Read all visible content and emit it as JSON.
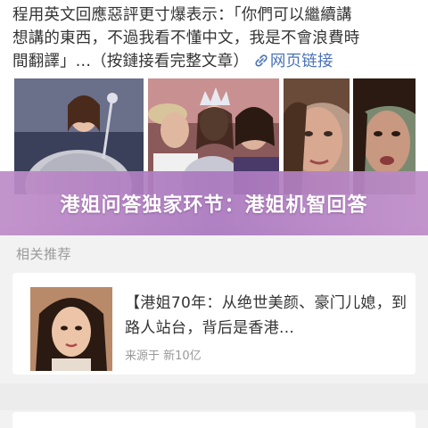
{
  "article": {
    "line1": "程用英文回應惡評更寸爆表示：「你們可以繼續講",
    "line2": "想講的東西，不過我看不懂中文，我是不會浪費時",
    "line3_text": "間翻譯」...（按鏈接看完整文章）",
    "link_label": "网页链接",
    "link_icon": "link-icon"
  },
  "photos": [
    {
      "name": "pageant-winner-photo"
    },
    {
      "name": "crowning-group-photo"
    },
    {
      "name": "portrait-closeup-photo"
    },
    {
      "name": "selfie-photo"
    }
  ],
  "banner": {
    "title": "港姐问答独家环节：港姐机智回答"
  },
  "recommend": {
    "section_label": "相关推荐",
    "title": "【港姐70年：从绝世美颜、豪门儿媳，到路人站台，背后是香港...",
    "source": "来源于 新10亿"
  },
  "colors": {
    "banner": "#b889c6",
    "link": "#4a72b8",
    "background": "#f2f2f2"
  }
}
